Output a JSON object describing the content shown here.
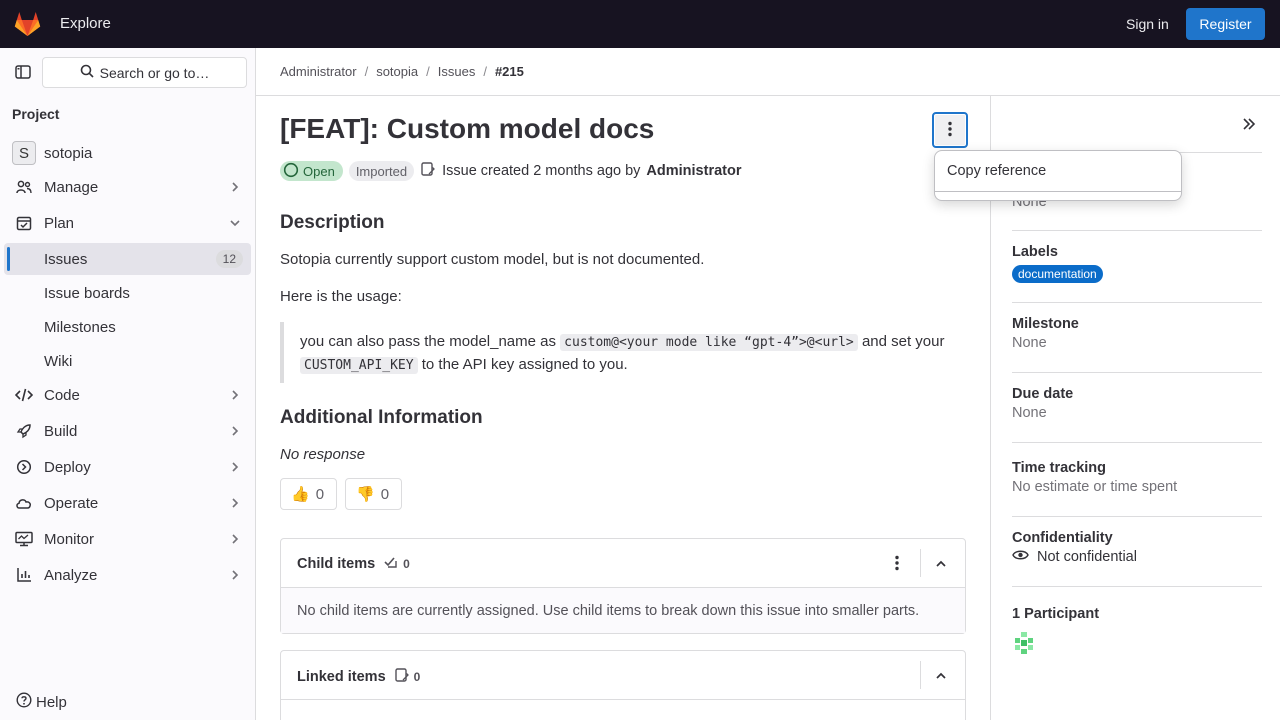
{
  "topbar": {
    "explore": "Explore",
    "sign_in": "Sign in",
    "register": "Register"
  },
  "sidebar": {
    "search_placeholder": "Search or go to…",
    "section": "Project",
    "project_initial": "S",
    "project_name": "sotopia",
    "items": [
      {
        "label": "Manage",
        "icon": "users-icon"
      },
      {
        "label": "Plan",
        "icon": "plan-icon"
      },
      {
        "label": "Issues",
        "count": "12"
      },
      {
        "label": "Issue boards"
      },
      {
        "label": "Milestones"
      },
      {
        "label": "Wiki"
      },
      {
        "label": "Code",
        "icon": "code-icon"
      },
      {
        "label": "Build",
        "icon": "rocket-icon"
      },
      {
        "label": "Deploy",
        "icon": "deploy-icon"
      },
      {
        "label": "Operate",
        "icon": "cloud-icon"
      },
      {
        "label": "Monitor",
        "icon": "monitor-icon"
      },
      {
        "label": "Analyze",
        "icon": "chart-icon"
      }
    ],
    "help": "Help"
  },
  "breadcrumb": [
    "Administrator",
    "sotopia",
    "Issues",
    "#215"
  ],
  "issue": {
    "title": "[FEAT]: Custom model docs",
    "status": "Open",
    "imported": "Imported",
    "created_text": "Issue created 2 months ago by",
    "author": "Administrator",
    "description_heading": "Description",
    "description": "Sotopia currently support custom model, but is not documented.",
    "usage_intro": "Here is the usage:",
    "quote_pre": "you can also pass the model_name as",
    "quote_code1": "custom@<your mode like “gpt-4”>@<url>",
    "quote_mid": "and set your",
    "quote_code2": "CUSTOM_API_KEY",
    "quote_post": "to the API key assigned to you.",
    "additional_heading": "Additional Information",
    "additional_text": "No response",
    "thumbs_up": "0",
    "thumbs_down": "0"
  },
  "child_items": {
    "title": "Child items",
    "count": "0",
    "empty": "No child items are currently assigned. Use child items to break down this issue into smaller parts."
  },
  "linked_items": {
    "title": "Linked items",
    "count": "0"
  },
  "dropdown": {
    "copy_reference": "Copy reference"
  },
  "right_sidebar": {
    "assignee_value": "None",
    "labels_label": "Labels",
    "label_tag": "documentation",
    "milestone_label": "Milestone",
    "milestone_value": "None",
    "due_label": "Due date",
    "due_value": "None",
    "time_label": "Time tracking",
    "time_value": "No estimate or time spent",
    "conf_label": "Confidentiality",
    "conf_value": "Not confidential",
    "participants_label": "1 Participant"
  },
  "colors": {
    "topbar": "#171321",
    "primary": "#1f75cb",
    "open_badge": "#c3e6cd",
    "label": "#0b6cc9"
  }
}
